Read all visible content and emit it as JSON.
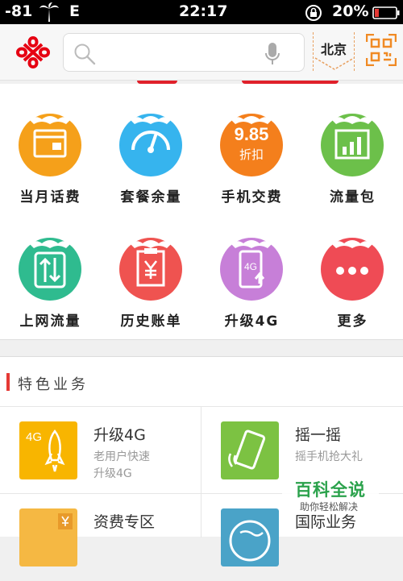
{
  "status_bar": {
    "signal": "-81",
    "network": "E",
    "time": "22:17",
    "battery": "20%"
  },
  "header": {
    "city": "北京",
    "search_placeholder": ""
  },
  "colors": {
    "brand_red": "#e60012",
    "accent_orange": "#f08a24"
  },
  "grid_items": [
    {
      "label": "当月话费",
      "icon": "calendar-bill-icon",
      "color": "#f5a01a"
    },
    {
      "label": "套餐余量",
      "icon": "gauge-icon",
      "color": "#36b4ee"
    },
    {
      "label": "手机交费",
      "icon": "discount-icon",
      "color": "#f47f1c",
      "badge_big": "9.85",
      "badge_small": "折扣"
    },
    {
      "label": "流量包",
      "icon": "bar-chart-icon",
      "color": "#6cc04a"
    },
    {
      "label": "上网流量",
      "icon": "up-down-arrows-icon",
      "color": "#2fbb8f"
    },
    {
      "label": "历史账单",
      "icon": "yuan-receipt-icon",
      "color": "#ef5350"
    },
    {
      "label": "升级4G",
      "icon": "phone-4g-icon",
      "color": "#c77fd8",
      "badge_small": "4G"
    },
    {
      "label": "更多",
      "icon": "more-dots-icon",
      "color": "#ef4b55"
    }
  ],
  "featured": {
    "title": "特色业务",
    "cards": [
      {
        "title": "升级4G",
        "lines": [
          "老用户快速",
          "升级4G"
        ],
        "icon": "rocket-4g-icon",
        "icon_text": "4G",
        "color": "#f8b500"
      },
      {
        "title": "摇一摇",
        "lines": [
          "摇手机抢大礼"
        ],
        "icon": "shake-phone-icon",
        "color": "#7cc242"
      },
      {
        "title": "资费专区",
        "lines": [],
        "icon": "price-tag-icon",
        "color": "#f5b843"
      },
      {
        "title": "国际业务",
        "lines": [],
        "icon": "globe-icon",
        "color": "#4aa3c8"
      }
    ]
  },
  "watermark": {
    "title": "百科全说",
    "subtitle": "助你轻松解决"
  }
}
